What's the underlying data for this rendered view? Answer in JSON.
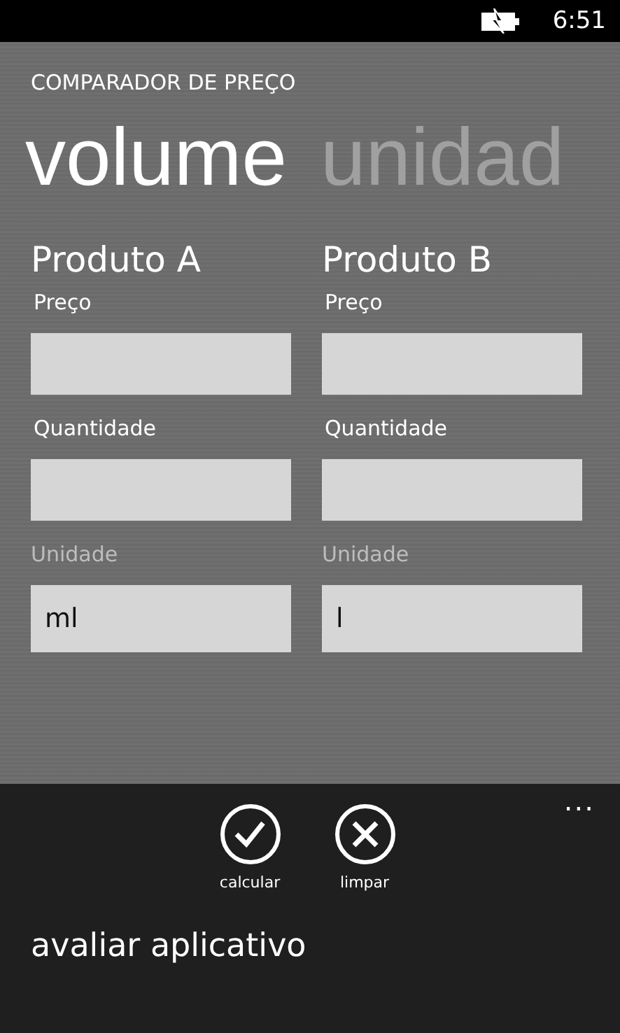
{
  "status_bar": {
    "time": "6:51"
  },
  "app_title": "COMPARADOR DE PREÇO",
  "pivot": [
    {
      "label": "volume",
      "selected": true
    },
    {
      "label": "unidad",
      "selected": false
    }
  ],
  "products": [
    {
      "title": "Produto A",
      "fields": [
        {
          "kind": "input",
          "label": "Preço"
        },
        {
          "kind": "input",
          "label": "Quantidade"
        },
        {
          "kind": "picker",
          "label": "Unidade",
          "value": "ml"
        }
      ]
    },
    {
      "title": "Produto B",
      "fields": [
        {
          "kind": "input",
          "label": "Preço"
        },
        {
          "kind": "input",
          "label": "Quantidade"
        },
        {
          "kind": "picker",
          "label": "Unidade",
          "value": "l"
        }
      ]
    }
  ],
  "app_bar": {
    "more": "...",
    "buttons": [
      {
        "kind": "check",
        "label": "calcular"
      },
      {
        "kind": "close",
        "label": "limpar"
      }
    ],
    "menu_items": [
      "avaliar aplicativo"
    ]
  }
}
